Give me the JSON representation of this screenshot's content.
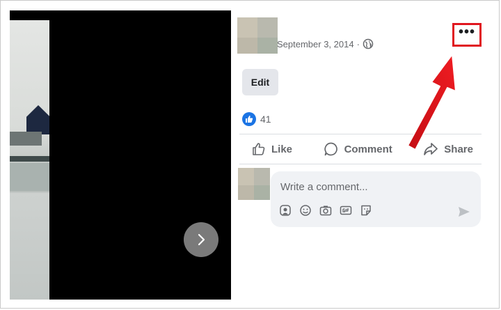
{
  "post": {
    "date": "September 3, 2014",
    "separator": "·",
    "audience_icon": "globe-icon",
    "more_label": "•••",
    "edit_label": "Edit",
    "reaction_count": "41"
  },
  "actions": {
    "like": "Like",
    "comment": "Comment",
    "share": "Share"
  },
  "composer": {
    "placeholder": "Write a comment...",
    "tools": [
      "avatar-sticker-icon",
      "emoji-icon",
      "camera-icon",
      "gif-icon",
      "sticker-icon"
    ],
    "send_icon": "send-icon"
  },
  "colors": {
    "highlight": "#e0161f",
    "like_blue": "#1b74e4",
    "viewer_bg": "#000000"
  }
}
